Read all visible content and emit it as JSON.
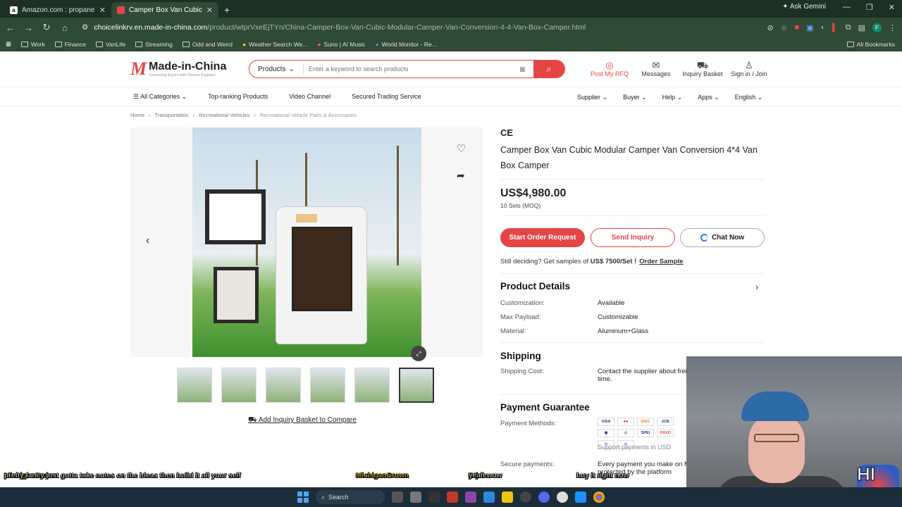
{
  "browser": {
    "tabs": [
      {
        "title": "Amazon.com : propane fridge",
        "favicon": "a"
      },
      {
        "title": "Camper Box Van Cubic Modular",
        "favicon": ""
      }
    ],
    "ask_gemini": "Ask Gemini",
    "url_domain": "choicelinkrv.en.made-in-china.com",
    "url_path": "/product/wtprVxeEjTYn/China-Camper-Box-Van-Cubic-Modular-Camper-Van-Conversion-4-4-Van-Box-Camper.html",
    "bookmarks": [
      "Work",
      "Finance",
      "VanLife",
      "Streaming",
      "Odd and Weird",
      "Weather Search We...",
      "Suno | AI Music",
      "World Monitor - Re..."
    ],
    "all_bookmarks": "All Bookmarks"
  },
  "site": {
    "logo_text": "Made-in-China",
    "logo_sub": "Connecting Buyers with Chinese Suppliers",
    "search_category": "Products",
    "search_placeholder": "Enter a keyword to search products",
    "header_links": [
      "Post My RFQ",
      "Messages",
      "Inquiry Basket",
      "Sign in / Join"
    ],
    "subnav": [
      "All Categories",
      "Top-ranking Products",
      "Video Channel",
      "Secured Trading Service"
    ],
    "subnav_right": [
      "Supplier",
      "Buyer",
      "Help",
      "Apps",
      "English"
    ],
    "breadcrumbs": [
      "Home",
      "Transportation",
      "Recreational Vehicles",
      "Recreational Vehicle Parts & Accessories"
    ]
  },
  "product": {
    "cert": "CE",
    "title": "Camper Box Van Cubic Modular Camper Van Conversion 4*4 Van Box Camper",
    "price": "US$4,980.00",
    "moq": "10 Sets (MOQ)",
    "btn_start": "Start Order Request",
    "btn_inquiry": "Send Inquiry",
    "btn_chat": "Chat Now",
    "samples_text": "Still deciding? Get samples of",
    "samples_price": "US$ 7500/Set !",
    "order_sample": "Order Sample",
    "add_basket": "Add Inquiry Basket to Compare",
    "details_heading": "Product Details",
    "details": [
      {
        "k": "Customization:",
        "v": "Available"
      },
      {
        "k": "Max Payload:",
        "v": "Customizable"
      },
      {
        "k": "Material:",
        "v": "Aluminum+Glass"
      }
    ],
    "shipping_heading": "Shipping",
    "shipping_cost_label": "Shipping Cost:",
    "shipping_cost_value": "Contact the supplier about frei",
    "shipping_cost_value2": "time.",
    "payment_heading": "Payment Guarantee",
    "payment_methods_label": "Payment Methods:",
    "payment_methods": [
      "VISA",
      "MC",
      "DISC",
      "JCB",
      "DC",
      "",
      "SPEI",
      "OXXO",
      "",
      ""
    ],
    "support_payments": "Support payments in USD",
    "secure_label": "Secure payments:",
    "secure_value": "Every payment you make on M",
    "secure_value2": "protected by the platform"
  },
  "stream_chat": [
    {
      "user": "MichiganGrown",
      "msg": "pretty fancy just gotta take notes on the ideas then build it all your self"
    },
    {
      "user": "MichiganGrown",
      "msg": ""
    },
    {
      "user": "Rtjah",
      "msg": "yeah wow"
    },
    {
      "user": "",
      "msg": "buy it right now"
    }
  ],
  "taskbar": {
    "search": "Search"
  },
  "stream_logo": "HI TV"
}
